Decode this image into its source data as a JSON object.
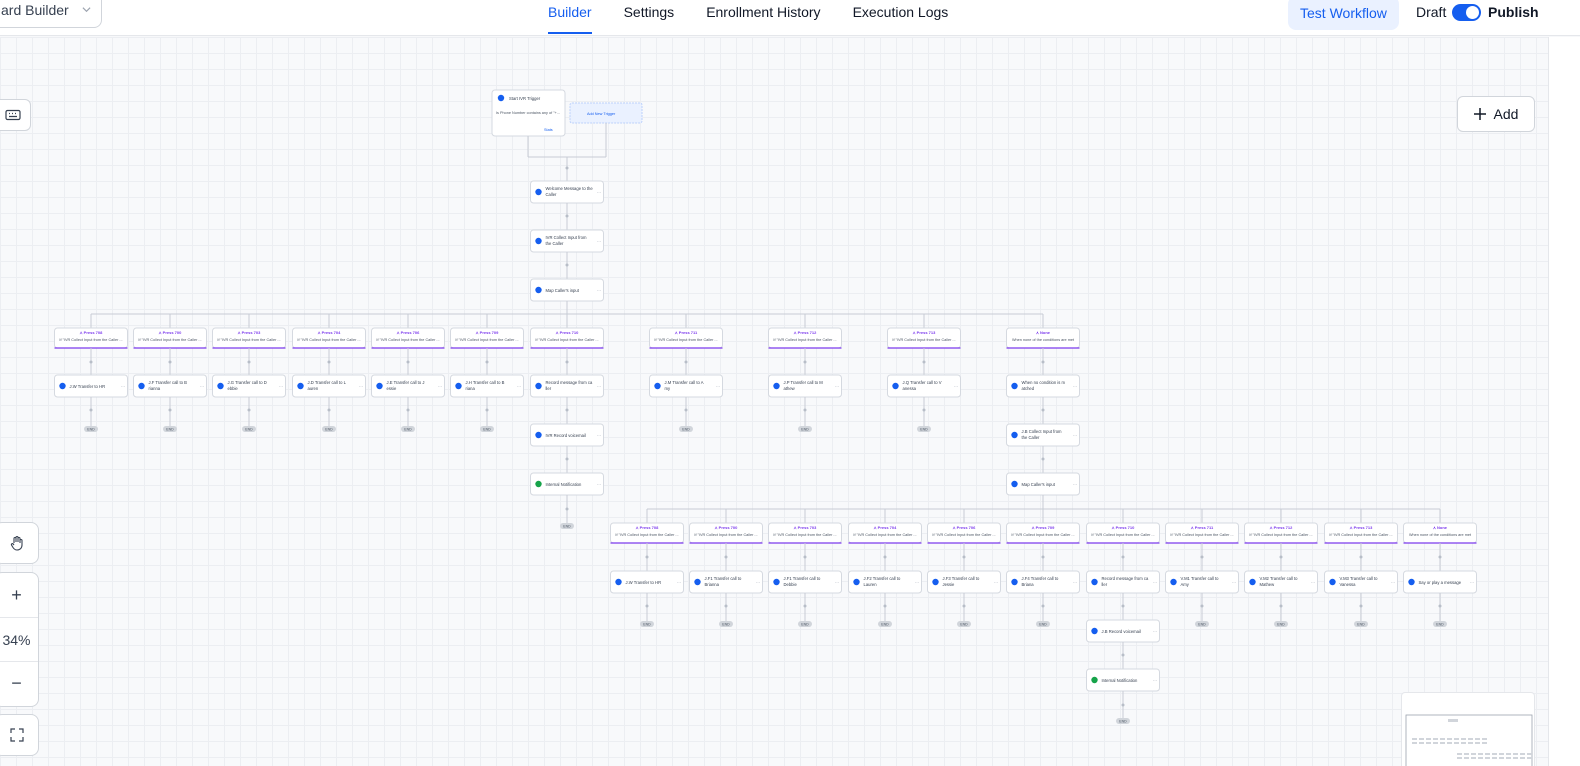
{
  "header": {
    "builder_select": "ard Builder",
    "tabs": [
      "Builder",
      "Settings",
      "Enrollment History",
      "Execution Logs"
    ],
    "active_tab": "Builder",
    "test_button": "Test Workflow",
    "draft_label": "Draft",
    "publish_label": "Publish",
    "publish_toggle_on": true
  },
  "canvas": {
    "add_button": "Add",
    "zoom_level": "34%",
    "zoom_in": "+",
    "zoom_out": "−"
  },
  "flow": {
    "trigger": {
      "title": "Start IVR Trigger",
      "detail": "Is Phone Number contains any of \"+...",
      "stats": "Stats",
      "add_trigger": "Add New Trigger"
    },
    "main_nodes": [
      "Welcome Message to the Caller",
      "IVR Collect Input from the Caller",
      "Map Caller's input"
    ],
    "branches_top": [
      {
        "label": "Press 708",
        "sub": "If \"IVR Collect Input from the Caller ...",
        "action": "J.W Transfer to HR"
      },
      {
        "label": "Press 700",
        "sub": "If \"IVR Collect Input from the Caller ...",
        "action": "J.F Transfer call to Brianna"
      },
      {
        "label": "Press 703",
        "sub": "If \"IVR Collect Input from the Caller ...",
        "action": "J.G Transfer call to Debbie"
      },
      {
        "label": "Press 704",
        "sub": "If \"IVR Collect Input from the Caller ...",
        "action": "J.D Transfer call to Lauren"
      },
      {
        "label": "Press 706",
        "sub": "If \"IVR Collect Input from the Caller ...",
        "action": "J.E Transfer call to Jessie"
      },
      {
        "label": "Press 709",
        "sub": "If \"IVR Collect Input from the Caller ...",
        "action": "J.H Transfer call to Briana"
      },
      {
        "label": "Press 710",
        "sub": "If \"IVR Collect Input from the Caller ...",
        "action": "Record message from caller"
      },
      {
        "label": "Press 711",
        "sub": "If \"IVR Collect Input from the Caller ...",
        "action": "J.M Transfer call to Amy"
      },
      {
        "label": "Press 712",
        "sub": "If \"IVR Collect Input from the Caller ...",
        "action": "J.P Transfer call to Mathew"
      },
      {
        "label": "Press 713",
        "sub": "If \"IVR Collect Input from the Caller ...",
        "action": "J.Q Transfer call to Vanessa"
      },
      {
        "label": "None",
        "sub": "When none of the conditions are met",
        "action": "When no condition is matched"
      }
    ],
    "record_chain": [
      "IVR Record voicemail",
      "Internal Notification"
    ],
    "none_chain": [
      "J.B Collect Input from the Caller",
      "Map Caller's input"
    ],
    "branches_bottom": [
      {
        "label": "Press 708",
        "sub": "If \"IVR Collect Input from the Caller ...",
        "action": "J.W Transfer to HR"
      },
      {
        "label": "Press 700",
        "sub": "If \"IVR Collect Input from the Caller ...",
        "action": "J.F1 Transfer call to Brianna"
      },
      {
        "label": "Press 703",
        "sub": "If \"IVR Collect Input from the Caller ...",
        "action": "J.F1 Transfer call to Debbie"
      },
      {
        "label": "Press 704",
        "sub": "If \"IVR Collect Input from the Caller ...",
        "action": "J.F2 Transfer call to Lauren"
      },
      {
        "label": "Press 706",
        "sub": "If \"IVR Collect Input from the Caller ...",
        "action": "J.F3 Transfer call to Jessie"
      },
      {
        "label": "Press 709",
        "sub": "If \"IVR Collect Input from the Caller ...",
        "action": "J.F4 Transfer call to Briana"
      },
      {
        "label": "Press 710",
        "sub": "If \"IVR Collect Input from the Caller ...",
        "action": "Record message from caller"
      },
      {
        "label": "Press 711",
        "sub": "If \"IVR Collect Input from the Caller ...",
        "action": "V.M1 Transfer call to Amy"
      },
      {
        "label": "Press 712",
        "sub": "If \"IVR Collect Input from the Caller ...",
        "action": "V.M2 Transfer call to Mathew"
      },
      {
        "label": "Press 713",
        "sub": "If \"IVR Collect Input from the Caller ...",
        "action": "V.M3 Transfer call to Vanessa"
      },
      {
        "label": "None",
        "sub": "When none of the conditions are met",
        "action": "Say or play a message"
      }
    ],
    "record_chain_bottom": [
      "J.B Record voicemail",
      "Internal Notification"
    ],
    "end_label": "END"
  },
  "colors": {
    "accent": "#155eef",
    "branch_purple": "#7c3aed",
    "notification_green": "#16a34a"
  }
}
